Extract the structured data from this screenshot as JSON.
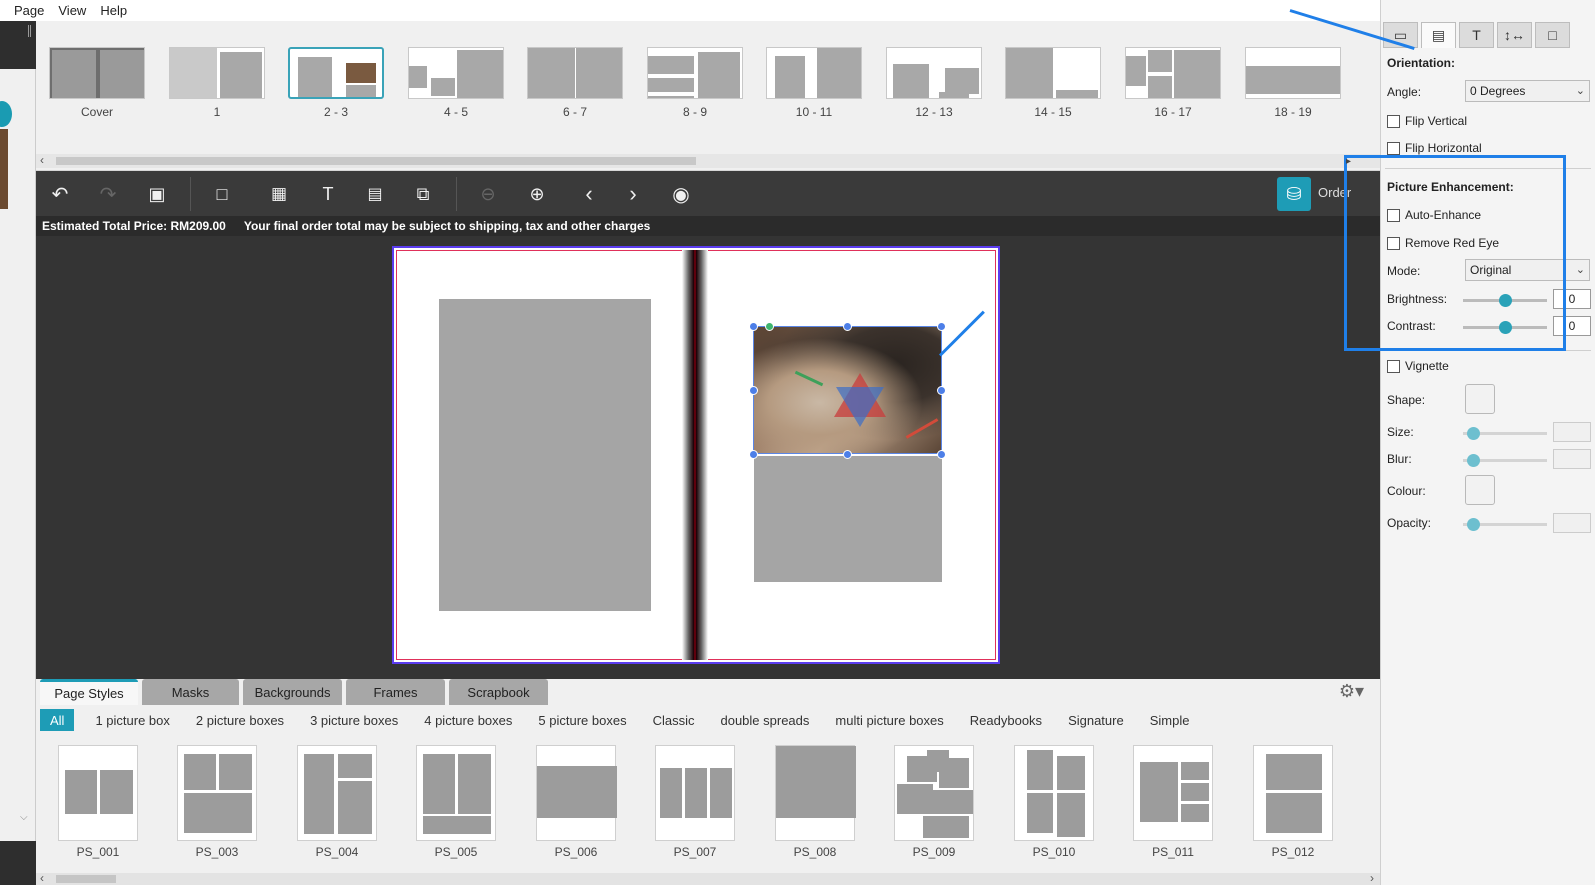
{
  "menu": [
    "Page",
    "View",
    "Help"
  ],
  "pages": [
    {
      "label": "Cover",
      "layout": "cover"
    },
    {
      "label": "1",
      "layout": "single-right"
    },
    {
      "label": "2 - 3",
      "layout": "photo-right",
      "selected": true
    },
    {
      "label": "4 - 5",
      "layout": "mixed-a"
    },
    {
      "label": "6 - 7",
      "layout": "full"
    },
    {
      "label": "8 - 9",
      "layout": "strips"
    },
    {
      "label": "10 - 11",
      "layout": "two-boxes"
    },
    {
      "label": "12 - 13",
      "layout": "offset"
    },
    {
      "label": "14 - 15",
      "layout": "right-low"
    },
    {
      "label": "16 - 17",
      "layout": "collage"
    },
    {
      "label": "18 - 19",
      "layout": "band"
    }
  ],
  "toolbar": {
    "icons": [
      "undo-icon",
      "redo-icon",
      "save-icon",
      "add-page-icon",
      "add-photo-icon",
      "add-text-icon",
      "background-icon",
      "rotate-page-icon",
      "zoom-out-icon",
      "zoom-in-icon",
      "prev-page-icon",
      "next-page-icon",
      "preview-icon"
    ],
    "order_label": "Order"
  },
  "price": {
    "estimated": "Estimated Total Price: RM209.00",
    "note": "Your final order total may be subject to shipping, tax and other charges"
  },
  "bottom_tabs": [
    {
      "label": "Page Styles",
      "active": true
    },
    {
      "label": "Masks"
    },
    {
      "label": "Backgrounds"
    },
    {
      "label": "Frames"
    },
    {
      "label": "Scrapbook"
    }
  ],
  "filters": [
    {
      "label": "All",
      "active": true
    },
    {
      "label": "1 picture box"
    },
    {
      "label": "2 picture boxes"
    },
    {
      "label": "3 picture boxes"
    },
    {
      "label": "4 picture boxes"
    },
    {
      "label": "5 picture boxes"
    },
    {
      "label": "Classic"
    },
    {
      "label": "double spreads"
    },
    {
      "label": "multi picture boxes"
    },
    {
      "label": "Readybooks"
    },
    {
      "label": "Signature"
    },
    {
      "label": "Simple"
    }
  ],
  "styles": [
    "PS_001",
    "PS_003",
    "PS_004",
    "PS_005",
    "PS_006",
    "PS_007",
    "PS_008",
    "PS_009",
    "PS_010",
    "PS_011",
    "PS_012"
  ],
  "panel": {
    "tabs": [
      "frame-tab-icon",
      "picture-tab-icon",
      "text-tab-icon",
      "spacing-tab-icon",
      "page-tab-icon"
    ],
    "orientation_head": "Orientation:",
    "angle_label": "Angle:",
    "angle_value": "0 Degrees",
    "flip_vertical": "Flip Vertical",
    "flip_horizontal": "Flip Horizontal",
    "enhance_head": "Picture Enhancement:",
    "auto_enhance": "Auto-Enhance",
    "red_eye": "Remove Red Eye",
    "mode_label": "Mode:",
    "mode_value": "Original",
    "brightness_label": "Brightness:",
    "brightness_value": "0",
    "contrast_label": "Contrast:",
    "contrast_value": "0",
    "vignette": "Vignette",
    "shape_label": "Shape:",
    "size_label": "Size:",
    "blur_label": "Blur:",
    "colour_label": "Colour:",
    "opacity_label": "Opacity:"
  },
  "colors": {
    "accent": "#1e9cb6",
    "annotation": "#1f7fe8",
    "toolbar": "#3a3a3a",
    "canvas": "#343434"
  }
}
